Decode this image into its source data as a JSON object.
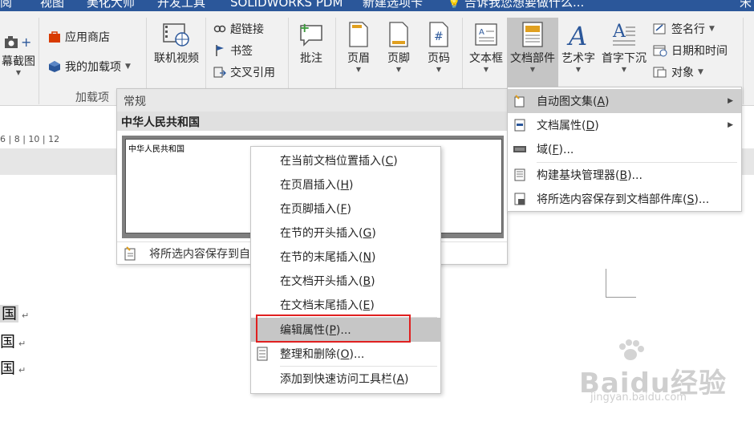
{
  "tabs": [
    "阅",
    "视图",
    "美化大师",
    "开发工具",
    "SOLIDWORKS PDM",
    "新建选项卡",
    "告诉我您想要做什么...",
    "宋"
  ],
  "ribbon": {
    "screenshot": "幕截图",
    "app_store": "应用商店",
    "my_addins": "我的加载项",
    "addins_group": "加载项",
    "online_video": "联机视频",
    "hyperlink": "超链接",
    "bookmark": "书签",
    "cross_ref": "交叉引用",
    "comment": "批注",
    "header": "页眉",
    "footer": "页脚",
    "page_number": "页码",
    "textbox": "文本框",
    "doc_parts": "文档部件",
    "wordart": "艺术字",
    "dropcap": "首字下沉",
    "signature": "签名行",
    "datetime": "日期和时间",
    "object": "对象"
  },
  "ruler_text": "6 | 8 | 10 | 12",
  "gallery": {
    "header": "常规",
    "entry_title": "中华人民共和国",
    "entry_preview": "中华人民共和国",
    "footer": "将所选内容保存到自"
  },
  "doc_parts_menu": [
    {
      "label": "自动图文集",
      "key": "A",
      "submenu": true
    },
    {
      "label": "文档属性",
      "key": "D",
      "submenu": true
    },
    {
      "label": "域",
      "key": "F",
      "suffix": "..."
    },
    {
      "label": "构建基块管理器",
      "key": "B",
      "suffix": "..."
    },
    {
      "label": "将所选内容保存到文档部件库",
      "key": "S",
      "suffix": "..."
    }
  ],
  "context_menu": [
    {
      "label": "在当前文档位置插入",
      "key": "C"
    },
    {
      "label": "在页眉插入",
      "key": "H"
    },
    {
      "label": "在页脚插入",
      "key": "F"
    },
    {
      "label": "在节的开头插入",
      "key": "G"
    },
    {
      "label": "在节的末尾插入",
      "key": "N"
    },
    {
      "label": "在文档开头插入",
      "key": "B"
    },
    {
      "label": "在文档末尾插入",
      "key": "E"
    },
    {
      "label": "编辑属性",
      "key": "P",
      "suffix": "..."
    },
    {
      "label": "整理和删除",
      "key": "O",
      "suffix": "..."
    },
    {
      "label": "添加到快速访问工具栏",
      "key": "A"
    }
  ],
  "doc_lines": [
    "国",
    "国",
    "国"
  ],
  "watermark": {
    "text": "Baidu经验",
    "url": "jingyan.baidu.com"
  },
  "colors": {
    "tabbar": "#2b579a",
    "highlight_box": "#e02020",
    "hover": "#c6c6c6"
  }
}
